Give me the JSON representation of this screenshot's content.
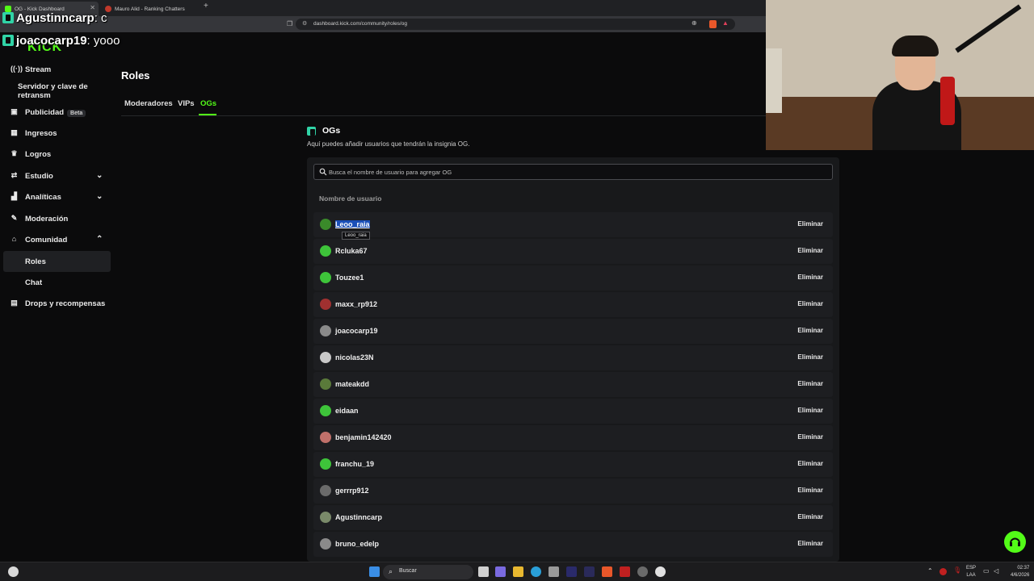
{
  "browser": {
    "tabs": [
      {
        "label": "OG - Kick Dashboard",
        "active": true
      },
      {
        "label": "Mauro Alid - Ranking Chatters",
        "active": false
      }
    ],
    "url": "dashboard.kick.com/community/roles/og"
  },
  "overlay_chat": [
    {
      "user": "Agustinncarp",
      "message": ": c"
    },
    {
      "user": "joacocarp19",
      "message": ": yooo"
    }
  ],
  "sidebar": {
    "items": [
      {
        "label": "Stream",
        "icon": "stream-icon"
      },
      {
        "label": "Servidor y clave de retransm",
        "icon": ""
      },
      {
        "label": "Publicidad",
        "badge": "Beta",
        "icon": "ad-icon"
      },
      {
        "label": "Ingresos",
        "icon": "revenue-icon"
      },
      {
        "label": "Logros",
        "icon": "trophy-icon"
      },
      {
        "label": "Estudio",
        "icon": "studio-icon"
      },
      {
        "label": "Analíticas",
        "icon": "analytics-icon"
      },
      {
        "label": "Moderación",
        "icon": "wrench-icon"
      },
      {
        "label": "Comunidad",
        "icon": "community-icon"
      },
      {
        "label": "Roles",
        "icon": ""
      },
      {
        "label": "Chat",
        "icon": ""
      },
      {
        "label": "Drops y recompensas",
        "icon": "gift-icon"
      }
    ]
  },
  "main": {
    "title": "Roles",
    "tabs": [
      {
        "label": "Moderadores"
      },
      {
        "label": "VIPs"
      },
      {
        "label": "OGs"
      }
    ],
    "section_title": "OGs",
    "section_description": "Aquí puedes añadir usuarios que tendrán la insignia OG.",
    "search_placeholder": "Busca el nombre de usuario para agregar OG",
    "column_header": "Nombre de usuario",
    "remove_label": "Eliminar",
    "tooltip": "Leoo_raia",
    "users": [
      {
        "name": "Leoo_raia",
        "avatar_color": "#3a8a2a"
      },
      {
        "name": "Rcluka67",
        "avatar_color": "#3ec43a"
      },
      {
        "name": "Touzee1",
        "avatar_color": "#3ec43a"
      },
      {
        "name": "maxx_rp912",
        "avatar_color": "#a03030"
      },
      {
        "name": "joacocarp19",
        "avatar_color": "#8a8a8a"
      },
      {
        "name": "nicolas23N",
        "avatar_color": "#c8c8c8"
      },
      {
        "name": "mateakdd",
        "avatar_color": "#5a7a3a"
      },
      {
        "name": "eidaan",
        "avatar_color": "#3ec43a"
      },
      {
        "name": "benjamin142420",
        "avatar_color": "#c0706a"
      },
      {
        "name": "franchu_19",
        "avatar_color": "#3ec43a"
      },
      {
        "name": "gerrrp912",
        "avatar_color": "#6a6a6a"
      },
      {
        "name": "Agustinncarp",
        "avatar_color": "#7a8a6a"
      },
      {
        "name": "bruno_edelp",
        "avatar_color": "#8a8a8a"
      }
    ]
  },
  "taskbar": {
    "search_label": "Buscar",
    "lang_line1": "ESP",
    "lang_line2": "LAA",
    "time": "02:37",
    "date": "4/6/2026"
  },
  "colors": {
    "accent": "#53fc18",
    "og_badge": "#30d3a6"
  }
}
